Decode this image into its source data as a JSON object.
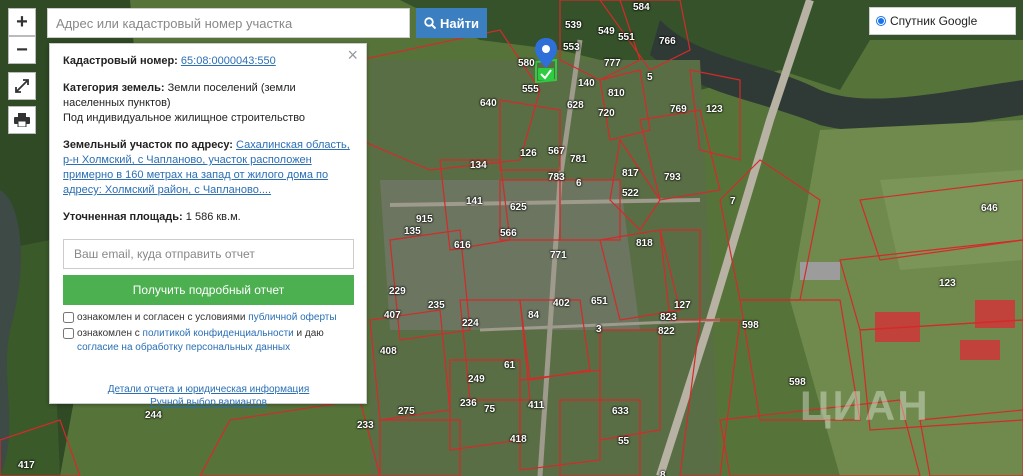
{
  "search": {
    "placeholder": "Адрес или кадастровый номер участка",
    "button_label": "Найти"
  },
  "zoom": {
    "in_label": "+",
    "out_label": "−"
  },
  "layer": {
    "selected": "Спутник Google"
  },
  "panel": {
    "cadastral_label": "Кадастровый номер:",
    "cadastral_value": "65:08:0000043:550",
    "category_label": "Категория земель:",
    "category_value": "Земли поселений (земли населенных пунктов)",
    "usage": "Под индивидуальное жилищное строительство",
    "address_label": "Земельный участок по адресу:",
    "address_value": "Сахалинская область, р-н Холмский, с Чапланово, участок расположен примерно в 160 метрах на запад от жилого дома по адресу: Холмский район, с Чапланово....",
    "area_label": "Уточненная площадь:",
    "area_value": "1 586 кв.м.",
    "email_placeholder": "Ваш email, куда отправить отчет",
    "report_button": "Получить подробный отчет",
    "offer_text": "ознакомлен и согласен с условиями",
    "offer_link": "публичной оферты",
    "privacy_text": "ознакомлен с",
    "privacy_link": "политикой конфиденциальности",
    "privacy_text2": "и даю",
    "consent_link": "согласие на обработку персональных данных",
    "details_link": "Детали отчета и юридическая информация",
    "manual_link": "Ручной выбор вариантов"
  },
  "parcels": [
    "539",
    "553",
    "549",
    "551",
    "584",
    "766",
    "580",
    "777",
    "555",
    "140",
    "640",
    "810",
    "628",
    "123",
    "720",
    "769",
    "126",
    "567",
    "781",
    "134",
    "783",
    "817",
    "793",
    "625",
    "522",
    "646",
    "141",
    "566",
    "771",
    "818",
    "135",
    "616",
    "915",
    "123",
    "229",
    "235",
    "402",
    "651",
    "127",
    "823",
    "822",
    "407",
    "224",
    "84",
    "3",
    "598",
    "408",
    "598",
    "249",
    "61",
    "275",
    "236",
    "75",
    "411",
    "633",
    "244",
    "233",
    "418",
    "55",
    "417",
    "7",
    "5",
    "6",
    "8"
  ],
  "watermark": "ЦИАН"
}
